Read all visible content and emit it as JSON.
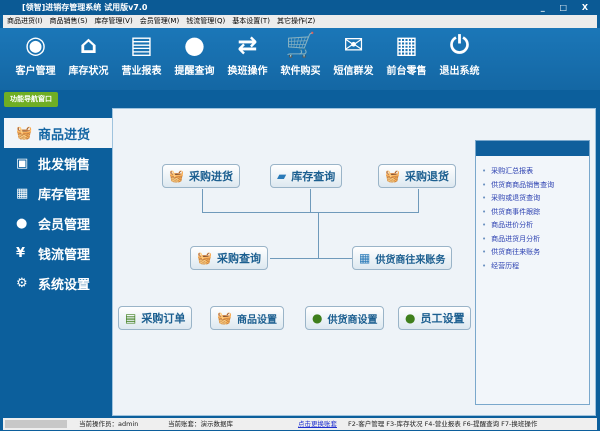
{
  "title": "[领智]进销存管理系统 试用版v7.0",
  "window_controls": "_ □ X",
  "menu": [
    "商品进货(I)",
    "商品销售(S)",
    "库存管理(V)",
    "会员管理(M)",
    "钱流管理(Q)",
    "基本设置(T)",
    "其它操作(Z)"
  ],
  "toolbar": [
    {
      "label": "客户管理",
      "icon": "user-circle-icon",
      "glyph": "◉"
    },
    {
      "label": "库存状况",
      "icon": "house-icon",
      "glyph": "⌂"
    },
    {
      "label": "营业报表",
      "icon": "report-icon",
      "glyph": "▤"
    },
    {
      "label": "提醒查询",
      "icon": "chat-user-icon",
      "glyph": "●"
    },
    {
      "label": "换班操作",
      "icon": "swap-icon",
      "glyph": "⇄"
    },
    {
      "label": "软件购买",
      "icon": "cart-icon",
      "glyph": "🛒"
    },
    {
      "label": "短信群发",
      "icon": "mail-icon",
      "glyph": "✉"
    },
    {
      "label": "前台零售",
      "icon": "cash-register-icon",
      "glyph": "▦"
    },
    {
      "label": "退出系统",
      "icon": "power-icon",
      "glyph": "⏻"
    }
  ],
  "nav_tab": "功能导航窗口",
  "sidebar": [
    {
      "label": "商品进货",
      "glyph": "🧺"
    },
    {
      "label": "批发销售",
      "glyph": "▣"
    },
    {
      "label": "库存管理",
      "glyph": "▦"
    },
    {
      "label": "会员管理",
      "glyph": "●"
    },
    {
      "label": "钱流管理",
      "glyph": "¥"
    },
    {
      "label": "系统设置",
      "glyph": "⚙"
    }
  ],
  "flow": {
    "purchase_in": "采购进货",
    "stock_query": "库存查询",
    "purchase_return": "采购退货",
    "purchase_query": "采购查询",
    "supplier_account": "供货商往来账务",
    "purchase_order": "采购订单",
    "goods_setting": "商品设置",
    "supplier_setting": "供货商设置",
    "staff_setting": "员工设置"
  },
  "reports": [
    "采购汇总报表",
    "供货商商品销售查询",
    "采购或退货查询",
    "供货商事件跟踪",
    "商品进价分析",
    "商品进货月分析",
    "供货商往来账务",
    "经营历程"
  ],
  "status": {
    "operator": "当前操作员：admin",
    "account": "当前账套：演示数据库",
    "switch_link": "点击更换账套",
    "shortcuts": "F2-客户管理 F3-库存状况 F4-营业报表 F6-提醒查询 F7-换班操作"
  }
}
